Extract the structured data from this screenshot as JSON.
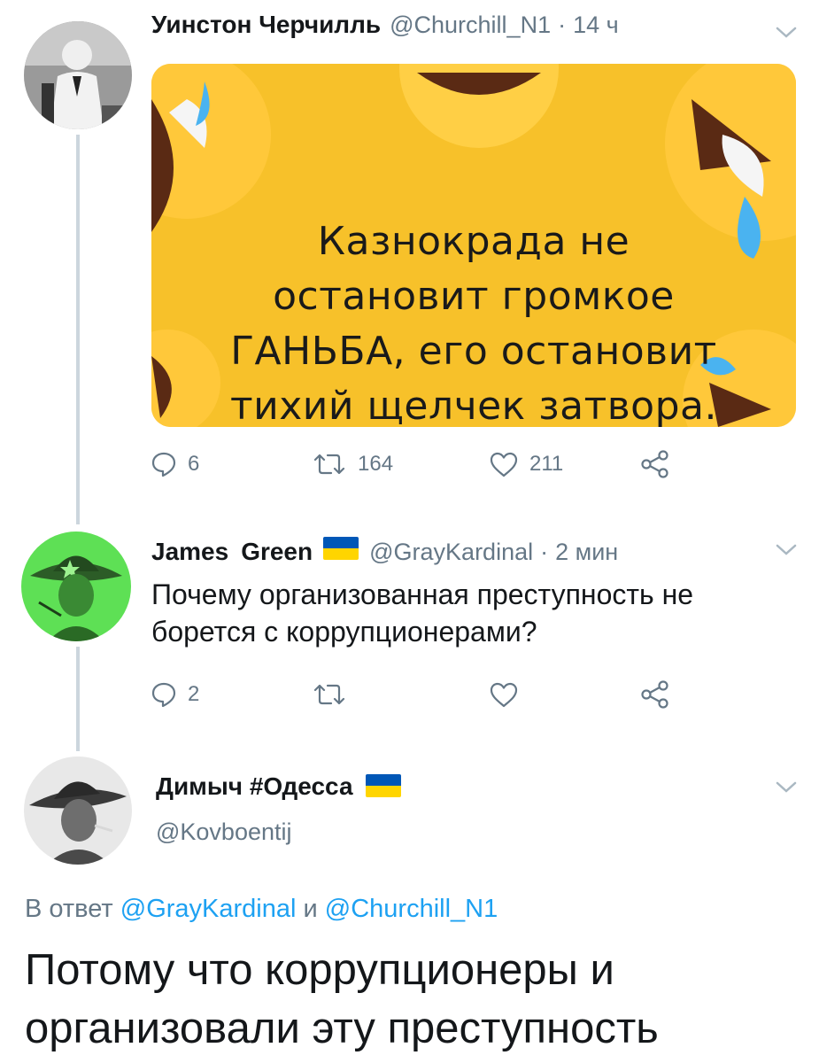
{
  "tweet1": {
    "name": "Уинстон Черчилль",
    "handle": "@Churchill_N1",
    "separator": "·",
    "time": "14 ч",
    "image_text": "Казнокрада не остановит громкое ГАНЬБА, его остановит тихий щелчек затвора.",
    "image_lines": [
      "Казнокрада не",
      "остановит громкое",
      "ГАНЬБА, его остановит",
      "тихий щелчек затвора."
    ],
    "stats": {
      "replies": "6",
      "retweets": "164",
      "likes": "211"
    }
  },
  "tweet2": {
    "first_name": "James",
    "last_name": "Green",
    "handle": "@GrayKardinal",
    "separator": "·",
    "time": "2 мин",
    "text_line1": "Почему организованная преступность не",
    "text_line2": "борется с коррупционерами?",
    "stats": {
      "replies": "2"
    }
  },
  "tweet3": {
    "name": "Димыч #Одесса",
    "handle": "@Kovboentij",
    "reply_prefix": "В ответ",
    "reply_user1": "@GrayKardinal",
    "reply_and": "и",
    "reply_user2": "@Churchill_N1",
    "text_line1": "Потому что коррупционеры и",
    "text_line2": "организовали эту преступность"
  },
  "icons": [
    "reply-icon",
    "retweet-icon",
    "like-icon",
    "share-icon",
    "chevron-down-icon",
    "ukraine-flag-icon"
  ],
  "colors": {
    "secondary": "#657786",
    "link": "#1da1f2",
    "meme_bg": "#f7c12a",
    "flag_blue": "#0057b7",
    "flag_yellow": "#ffd500"
  }
}
